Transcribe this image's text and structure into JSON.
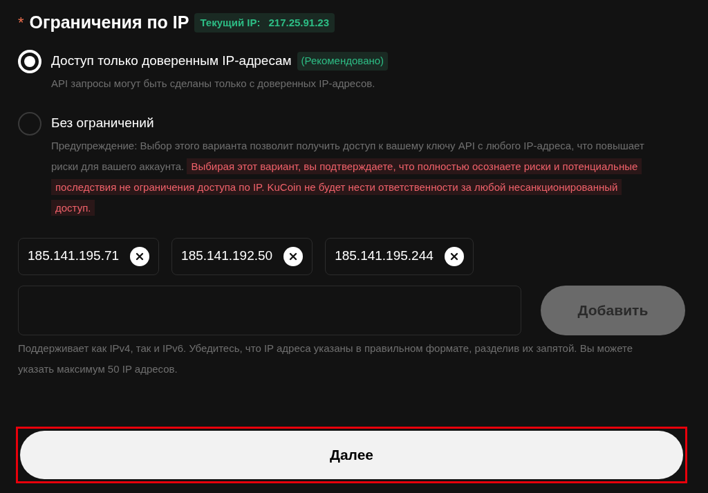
{
  "header": {
    "required_mark": "*",
    "title": "Ограничения по IP",
    "current_ip_label": "Текущий IP:",
    "current_ip": "217.25.91.23"
  },
  "options": [
    {
      "label": "Доступ только доверенным IP-адресам",
      "badge": "(Рекомендовано)",
      "selected": true,
      "description": "API запросы могут быть сделаны только с доверенных IP-адресов."
    },
    {
      "label": "Без ограничений",
      "selected": false,
      "description": "Предупреждение: Выбор этого варианта позволит получить доступ к вашему ключу API с любого IP-адреса, что повышает риски для вашего аккаунта.",
      "warning": "Выбирая этот вариант, вы подтверждаете, что полностью осознаете риски и потенциальные последствия не ограничения доступа по IP. KuCoin не будет нести ответственности за любой несанкционированный доступ."
    }
  ],
  "ip_tags": [
    "185.141.195.71",
    "185.141.192.50",
    "185.141.195.244"
  ],
  "add_button": {
    "label": "Добавить",
    "disabled": true
  },
  "hint": "Поддерживает как IPv4, так и IPv6. Убедитесь, что IP адреса указаны в правильном формате, разделив их запятой. Вы можете указать максимум 50 IP адресов.",
  "next_button": {
    "label": "Далее",
    "highlighted": true
  }
}
